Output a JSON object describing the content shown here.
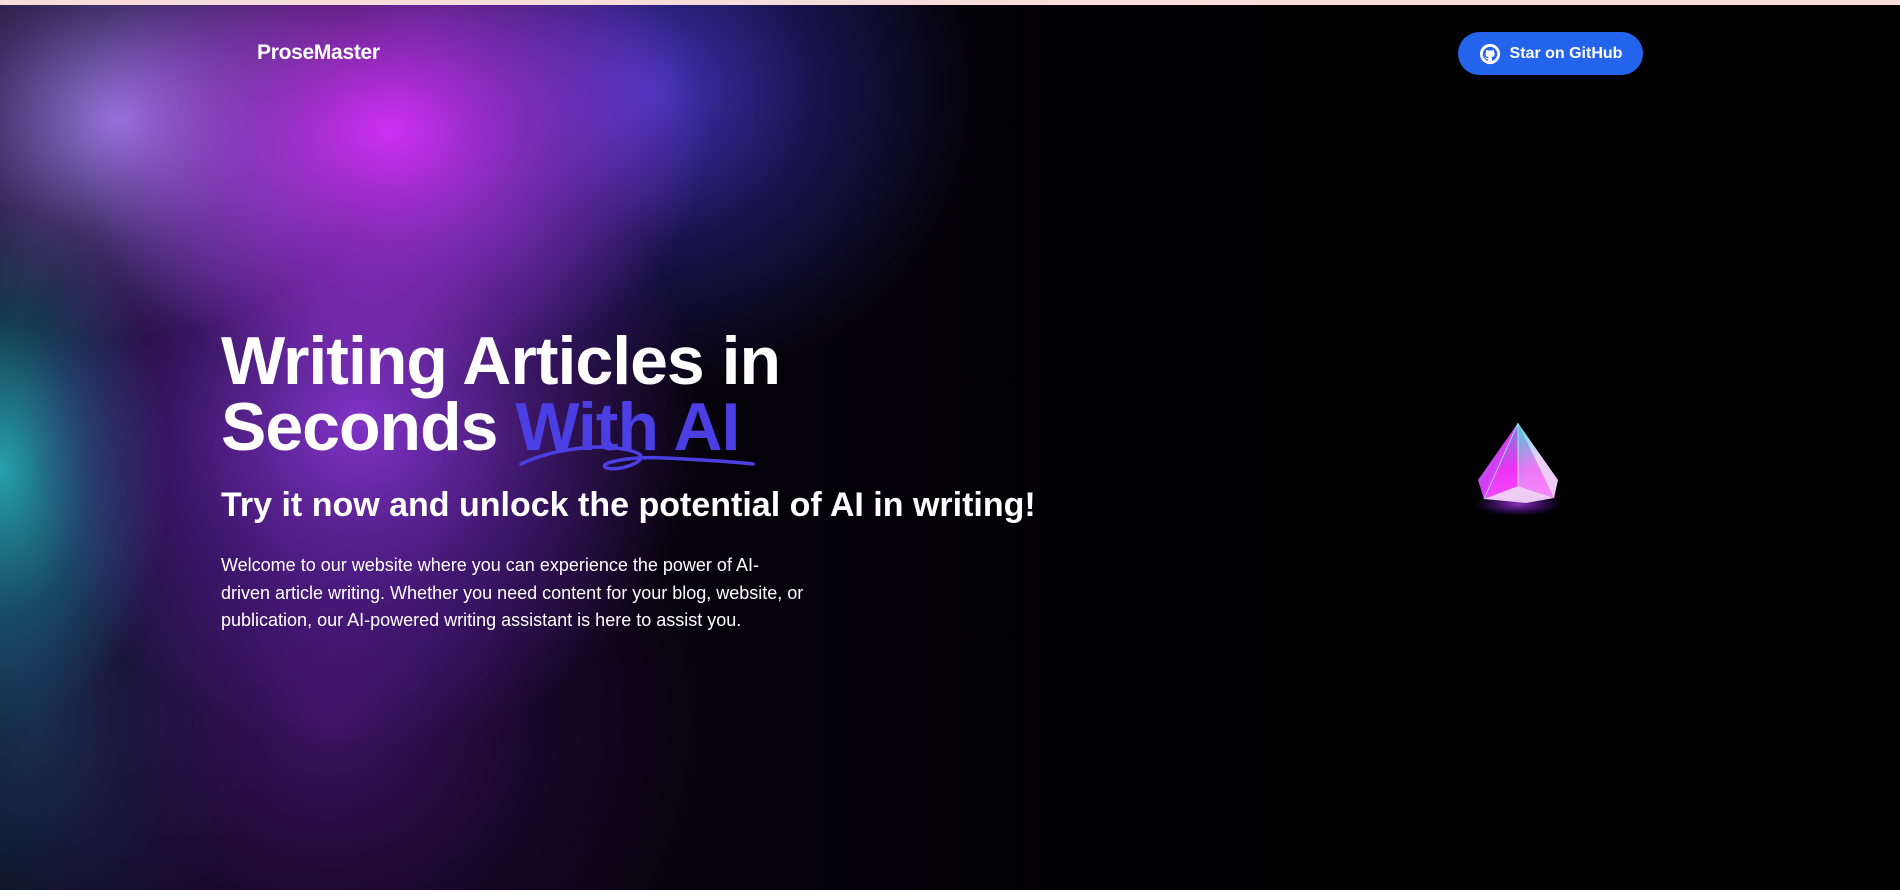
{
  "brand": {
    "name": "ProseMaster"
  },
  "nav": {
    "github_button_label": "Star on GitHub",
    "github_icon": "github-icon"
  },
  "hero": {
    "title_line1": "Writing Articles in",
    "title_line2_plain": "Seconds ",
    "title_line2_accent": "With AI",
    "tagline": "Try it now and unlock the potential of AI in writing!",
    "description": "Welcome to our website where you can experience the power of AI-driven article writing. Whether you need content for your blog, website, or publication, our AI-powered writing assistant is here to assist you."
  },
  "decoration": {
    "crystal_icon": "crystal-pyramid-icon",
    "scribble_icon": "scribble-underline-icon"
  },
  "colors": {
    "background": "#000000",
    "accent_text": "#4b3fe3",
    "button": "#2463eb",
    "glow_magenta": "#d732ff",
    "glow_teal": "#28aab4",
    "top_strip": "#f7dcdc"
  }
}
